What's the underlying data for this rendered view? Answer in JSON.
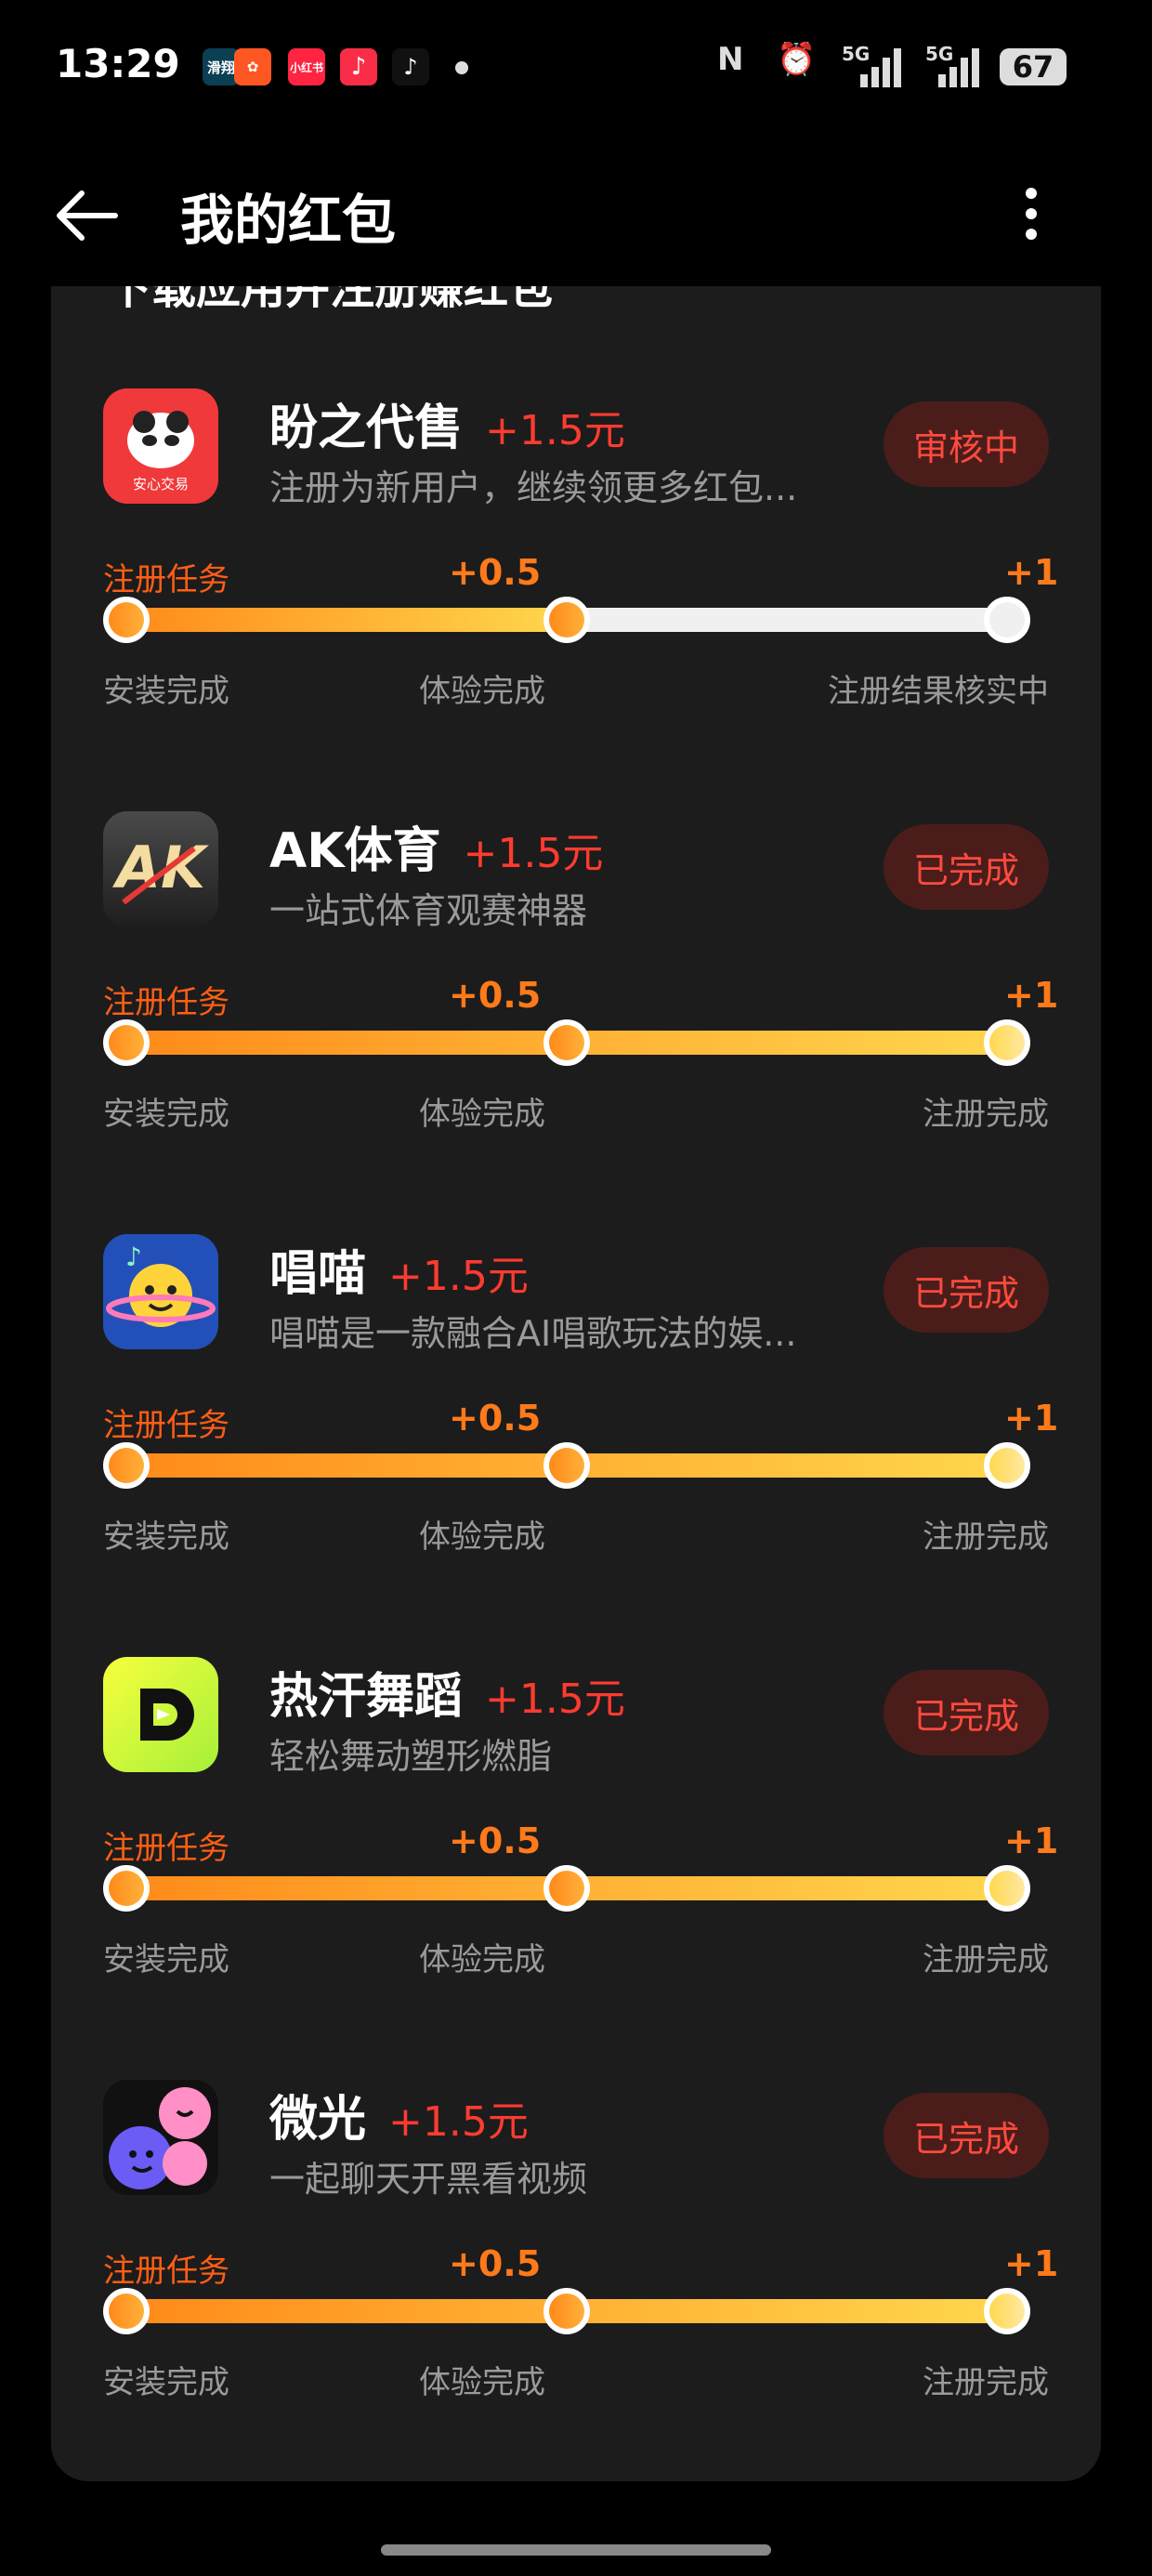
{
  "status_bar": {
    "time": "13:29",
    "notifications": [
      "滑翔",
      "小红书"
    ],
    "network1": "5G",
    "network2": "5G",
    "battery": "67"
  },
  "header": {
    "title": "我的红包"
  },
  "section_cutoff_text": "下载应用并注册赚红包",
  "items": [
    {
      "name": "盼之代售",
      "reward": "+1.5元",
      "desc": "注册为新用户，继续领更多红包...",
      "status": "审核中",
      "icon_label": "安心交易",
      "task_label": "注册任务",
      "mid_reward": "+0.5",
      "end_reward": "+1",
      "steps": [
        "安装完成",
        "体验完成",
        "注册结果核实中"
      ],
      "progress": 0.5
    },
    {
      "name": "AK体育",
      "reward": "+1.5元",
      "desc": "一站式体育观赛神器",
      "status": "已完成",
      "task_label": "注册任务",
      "mid_reward": "+0.5",
      "end_reward": "+1",
      "steps": [
        "安装完成",
        "体验完成",
        "注册完成"
      ],
      "progress": 1
    },
    {
      "name": "唱喵",
      "reward": "+1.5元",
      "desc": "唱喵是一款融合AI唱歌玩法的娱...",
      "status": "已完成",
      "task_label": "注册任务",
      "mid_reward": "+0.5",
      "end_reward": "+1",
      "steps": [
        "安装完成",
        "体验完成",
        "注册完成"
      ],
      "progress": 1
    },
    {
      "name": "热汗舞蹈",
      "reward": "+1.5元",
      "desc": "轻松舞动塑形燃脂",
      "status": "已完成",
      "task_label": "注册任务",
      "mid_reward": "+0.5",
      "end_reward": "+1",
      "steps": [
        "安装完成",
        "体验完成",
        "注册完成"
      ],
      "progress": 1
    },
    {
      "name": "微光",
      "reward": "+1.5元",
      "desc": "一起聊天开黑看视频",
      "status": "已完成",
      "task_label": "注册任务",
      "mid_reward": "+0.5",
      "end_reward": "+1",
      "steps": [
        "安装完成",
        "体验完成",
        "注册完成"
      ],
      "progress": 1
    }
  ]
}
